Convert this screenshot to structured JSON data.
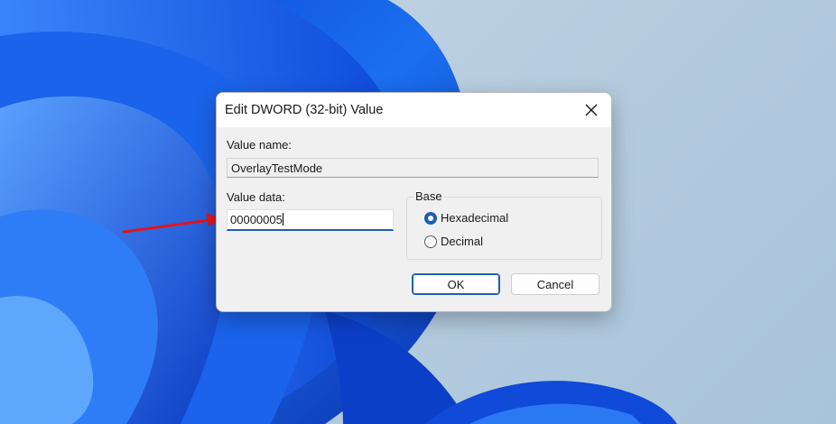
{
  "dialog": {
    "title": "Edit DWORD (32-bit) Value",
    "close_icon": "close-icon",
    "value_name_label": "Value name:",
    "value_name": "OverlayTestMode",
    "value_data_label": "Value data:",
    "value_data": "00000005",
    "base_label": "Base",
    "base_options": [
      {
        "label": "Hexadecimal",
        "selected": true
      },
      {
        "label": "Decimal",
        "selected": false
      }
    ],
    "ok_label": "OK",
    "cancel_label": "Cancel"
  },
  "annotation": {
    "arrow_color": "#e0161e"
  },
  "colors": {
    "accent": "#1f5fae",
    "dialog_bg": "#f0f0f0",
    "wallpaper_blue": "#1463e6"
  }
}
